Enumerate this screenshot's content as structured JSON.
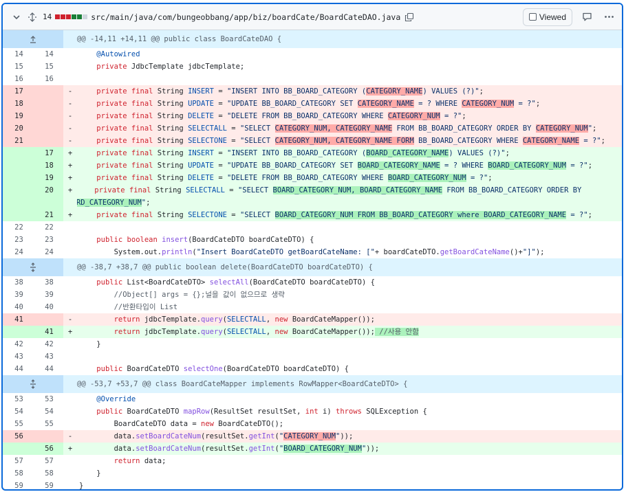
{
  "file": {
    "additions_count": "14",
    "path": "src/main/java/com/bungeobbang/app/biz/boardCate/BoardCateDAO.java",
    "viewed_label": "Viewed",
    "diffstat": [
      "del",
      "del",
      "del",
      "add",
      "add",
      "neu"
    ]
  },
  "colors": {
    "accent": "#0969da",
    "deletion": "#cf222e",
    "addition": "#1a7f37"
  },
  "hunks": [
    "@@ -14,11 +14,11 @@ public class BoardCateDAO {",
    "@@ -38,7 +38,7 @@ public boolean delete(BoardCateDTO boardCateDTO) {",
    "@@ -53,7 +53,7 @@ class BoardCateMapper implements RowMapper<BoardCateDTO> {"
  ],
  "lines": [
    {
      "type": "ctx",
      "old": "14",
      "new": "14",
      "code": "    @Autowired"
    },
    {
      "type": "ctx",
      "old": "15",
      "new": "15",
      "code": "    private JdbcTemplate jdbcTemplate;"
    },
    {
      "type": "ctx",
      "old": "16",
      "new": "16",
      "code": ""
    },
    {
      "type": "del",
      "old": "17",
      "new": "",
      "code": "    private final String INSERT = \"INSERT INTO BB_BOARD_CATEGORY (CATEGORY_NAME) VALUES (?)\";"
    },
    {
      "type": "del",
      "old": "18",
      "new": "",
      "code": "    private final String UPDATE = \"UPDATE BB_BOARD_CATEGORY SET CATEGORY_NAME = ? WHERE CATEGORY_NUM = ?\";"
    },
    {
      "type": "del",
      "old": "19",
      "new": "",
      "code": "    private final String DELETE = \"DELETE FROM BB_BOARD_CATEGORY WHERE CATEGORY_NUM = ?\";"
    },
    {
      "type": "del",
      "old": "20",
      "new": "",
      "code": "    private final String SELECTALL = \"SELECT CATEGORY_NUM, CATEGORY_NAME FROM BB_BOARD_CATEGORY ORDER BY CATEGORY_NUM\";"
    },
    {
      "type": "del",
      "old": "21",
      "new": "",
      "code": "    private final String SELECTONE = \"SELECT CATEGORY_NUM, CATEGORY_NAME FORM BB_BOARD_CATEGORY WHERE CATEGORY_NAME = ?\";"
    },
    {
      "type": "add",
      "old": "",
      "new": "17",
      "code": "    private final String INSERT = \"INSERT INTO BB_BOARD_CATEGORY (BOARD_CATEGORY_NAME) VALUES (?)\";"
    },
    {
      "type": "add",
      "old": "",
      "new": "18",
      "code": "    private final String UPDATE = \"UPDATE BB_BOARD_CATEGORY SET BOARD_CATEGORY_NAME = ? WHERE BOARD_CATEGORY_NUM = ?\";"
    },
    {
      "type": "add",
      "old": "",
      "new": "19",
      "code": "    private final String DELETE = \"DELETE FROM BB_BOARD_CATEGORY WHERE BOARD_CATEGORY_NUM = ?\";"
    },
    {
      "type": "add",
      "old": "",
      "new": "20",
      "code": "    private final String SELECTALL = \"SELECT BOARD_CATEGORY_NUM, BOARD_CATEGORY_NAME FROM BB_BOARD_CATEGORY ORDER BY",
      "code_cont": "BOARD_CATEGORY_NUM\";"
    },
    {
      "type": "add",
      "old": "",
      "new": "21",
      "code": "    private final String SELECTONE = \"SELECT BOARD_CATEGORY_NUM FROM BB_BOARD_CATEGORY where BOARD_CATEGORY_NAME = ?\";"
    },
    {
      "type": "ctx",
      "old": "22",
      "new": "22",
      "code": ""
    },
    {
      "type": "ctx",
      "old": "23",
      "new": "23",
      "code": "    public boolean insert(BoardCateDTO boardCateDTO) {"
    },
    {
      "type": "ctx",
      "old": "24",
      "new": "24",
      "code": "        System.out.println(\"Insert BoardCateDTO getBoardCateName: [\"+ boardCateDTO.getBoardCateName()+\"]\");"
    },
    {
      "type": "ctx",
      "old": "38",
      "new": "38",
      "code": "    public List<BoardCateDTO> selectAll(BoardCateDTO boardCateDTO) {"
    },
    {
      "type": "ctx",
      "old": "39",
      "new": "39",
      "code": "        //Object[] args = {};널을 값이 없으므로 생략"
    },
    {
      "type": "ctx",
      "old": "40",
      "new": "40",
      "code": "        //반환타입이 List"
    },
    {
      "type": "del",
      "old": "41",
      "new": "",
      "code": "        return jdbcTemplate.query(SELECTALL, new BoardCateMapper());"
    },
    {
      "type": "add",
      "old": "",
      "new": "41",
      "code": "        return jdbcTemplate.query(SELECTALL, new BoardCateMapper()); //사용 안함"
    },
    {
      "type": "ctx",
      "old": "42",
      "new": "42",
      "code": "    }"
    },
    {
      "type": "ctx",
      "old": "43",
      "new": "43",
      "code": ""
    },
    {
      "type": "ctx",
      "old": "44",
      "new": "44",
      "code": "    public BoardCateDTO selectOne(BoardCateDTO boardCateDTO) {"
    },
    {
      "type": "ctx",
      "old": "53",
      "new": "53",
      "code": "    @Override"
    },
    {
      "type": "ctx",
      "old": "54",
      "new": "54",
      "code": "    public BoardCateDTO mapRow(ResultSet resultSet, int i) throws SQLException {"
    },
    {
      "type": "ctx",
      "old": "55",
      "new": "55",
      "code": "        BoardCateDTO data = new BoardCateDTO();"
    },
    {
      "type": "del",
      "old": "56",
      "new": "",
      "code": "        data.setBoardCateNum(resultSet.getInt(\"CATEGORY_NUM\"));"
    },
    {
      "type": "add",
      "old": "",
      "new": "56",
      "code": "        data.setBoardCateNum(resultSet.getInt(\"BOARD_CATEGORY_NUM\"));"
    },
    {
      "type": "ctx",
      "old": "57",
      "new": "57",
      "code": "        return data;"
    },
    {
      "type": "ctx",
      "old": "58",
      "new": "58",
      "code": "    }"
    },
    {
      "type": "ctx",
      "old": "59",
      "new": "59",
      "code": "}"
    }
  ]
}
